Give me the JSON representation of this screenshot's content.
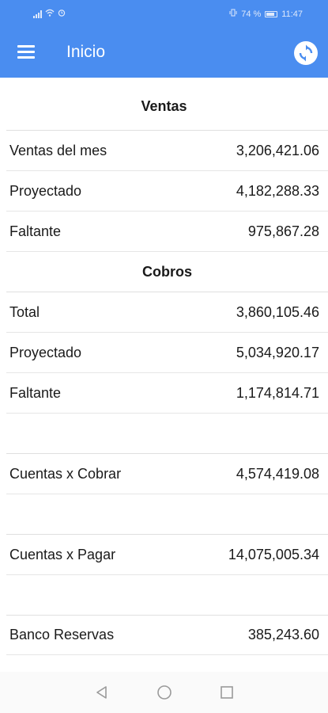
{
  "status": {
    "battery_text": "74 %",
    "time": "11:47"
  },
  "app": {
    "title": "Inicio"
  },
  "sections": {
    "ventas": {
      "title": "Ventas",
      "rows": [
        {
          "label": "Ventas del mes",
          "value": "3,206,421.06"
        },
        {
          "label": "Proyectado",
          "value": "4,182,288.33"
        },
        {
          "label": "Faltante",
          "value": "975,867.28"
        }
      ]
    },
    "cobros": {
      "title": "Cobros",
      "rows": [
        {
          "label": "Total",
          "value": "3,860,105.46"
        },
        {
          "label": "Proyectado",
          "value": "5,034,920.17"
        },
        {
          "label": "Faltante",
          "value": "1,174,814.71"
        }
      ]
    },
    "cuentas_cobrar": {
      "label": "Cuentas x Cobrar",
      "value": "4,574,419.08"
    },
    "cuentas_pagar": {
      "label": "Cuentas x Pagar",
      "value": "14,075,005.34"
    },
    "banco": {
      "label": "Banco Reservas",
      "value": "385,243.60"
    }
  },
  "icons": {
    "menu": "hamburger-icon",
    "refresh": "refresh-icon",
    "back": "triangle-back-icon",
    "home": "circle-home-icon",
    "recents": "square-recents-icon"
  },
  "colors": {
    "accent": "#4a8df0"
  }
}
